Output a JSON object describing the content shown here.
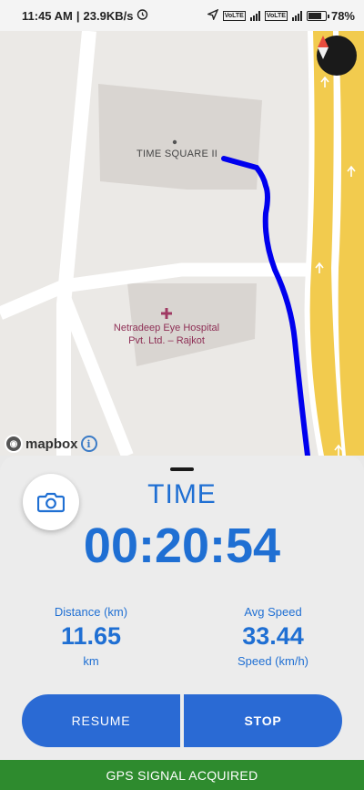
{
  "status_bar": {
    "time": "11:45 AM",
    "network_speed": "23.9KB/s",
    "sim1_tag": "VoLTE",
    "sim2_tag": "VoLTE",
    "network_type": "4G",
    "battery": "78%"
  },
  "map": {
    "place_label": "TIME SQUARE II",
    "poi_label_line1": "Netradeep Eye Hospital",
    "poi_label_line2": "Pvt. Ltd. – Rajkot",
    "attribution": "mapbox",
    "info_symbol": "i"
  },
  "tracker": {
    "title": "TIME",
    "elapsed": "00:20:54",
    "distance_label": "Distance (km)",
    "distance_value": "11.65",
    "distance_unit": "km",
    "speed_label": "Avg Speed",
    "speed_value": "33.44",
    "speed_unit": "Speed (km/h)"
  },
  "buttons": {
    "resume": "RESUME",
    "stop": "STOP"
  },
  "banner": {
    "gps_status": "GPS SIGNAL ACQUIRED"
  },
  "colors": {
    "accent": "#1f6fd3",
    "button": "#2a6ad4",
    "route": "#0000ee",
    "banner": "#2e8b2e",
    "highway": "#f2cb4e"
  }
}
